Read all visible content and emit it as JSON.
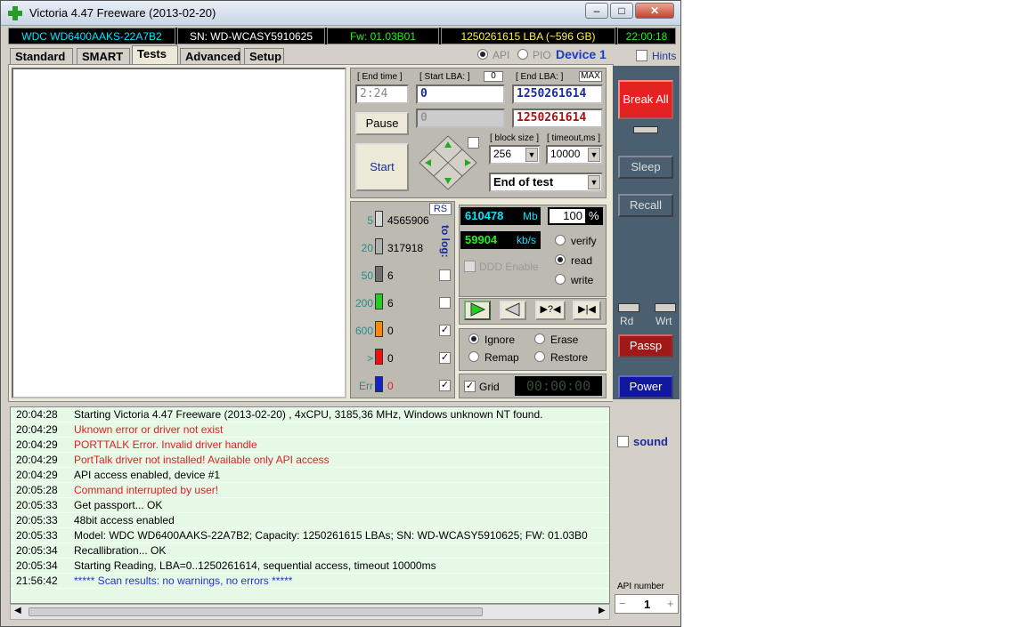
{
  "window": {
    "title": "Victoria 4.47  Freeware (2013-02-20)",
    "min": "–",
    "max": "□",
    "close": "✕"
  },
  "info": {
    "model": "WDC WD6400AAKS-22A7B2",
    "serial": "SN: WD-WCASY5910625",
    "fw": "Fw: 01.03B01",
    "lba": "1250261615 LBA (~596 GB)",
    "time": "22:00:18"
  },
  "tabs": [
    "Standard",
    "SMART",
    "Tests",
    "Advanced",
    "Setup"
  ],
  "mode": {
    "api": "API",
    "pio": "PIO",
    "device": "Device 1",
    "hints": "Hints"
  },
  "tests": {
    "end_time_label": "[ End time ]",
    "end_time": "2:24",
    "start_lba_label": "[ Start LBA: ]",
    "start_lba_badge": "0",
    "start_lba": "0",
    "start_lba2": "0",
    "end_lba_label": "[ End LBA: ]",
    "end_lba_badge": "MAX",
    "end_lba": "1250261614",
    "end_lba2": "1250261614",
    "pause": "Pause",
    "start": "Start",
    "block_size_label": "[ block size ]",
    "block_size": "256",
    "timeout_label": "[ timeout,ms ]",
    "timeout": "10000",
    "end_action": "End of test"
  },
  "blocks": {
    "rs": "RS",
    "to_log": "to log:",
    "rows": [
      {
        "label": "5",
        "count": "4565906",
        "color": "#d8d8d8"
      },
      {
        "label": "20",
        "count": "317918",
        "color": "#b0b0b0"
      },
      {
        "label": "50",
        "count": "6",
        "color": "#707070"
      },
      {
        "label": "200",
        "count": "6",
        "color": "#22cc22"
      },
      {
        "label": "600",
        "count": "0",
        "color": "#ff8800"
      },
      {
        "label": ">",
        "count": "0",
        "color": "#ee1111"
      },
      {
        "label": "Err",
        "count": "0",
        "color": "#1122cc"
      }
    ]
  },
  "stats": {
    "mb": "610478",
    "mb_unit": "Mb",
    "percent": "100",
    "percent_unit": "%",
    "speed": "59904",
    "speed_unit": "kb/s",
    "ddd": "DDD Enable",
    "verify": "verify",
    "read": "read",
    "write": "write"
  },
  "actions": {
    "ignore": "Ignore",
    "erase": "Erase",
    "remap": "Remap",
    "restore": "Restore",
    "grid": "Grid",
    "timer": "00:00:00"
  },
  "right": {
    "break_all": "Break All",
    "sleep": "Sleep",
    "recall": "Recall",
    "rd": "Rd",
    "wrt": "Wrt",
    "passp": "Passp",
    "power": "Power",
    "sound": "sound",
    "api_number_label": "API number",
    "api_number": "1",
    "minus": "−",
    "plus": "+"
  },
  "log": [
    {
      "t": "20:04:28",
      "m": "Starting Victoria 4.47  Freeware (2013-02-20) , 4xCPU, 3185,36 MHz, Windows unknown NT found.",
      "c": "#000000"
    },
    {
      "t": "20:04:29",
      "m": "Uknown error or driver not exist",
      "c": "#dd2222"
    },
    {
      "t": "20:04:29",
      "m": "PORTTALK Error. Invalid driver handle",
      "c": "#dd2222"
    },
    {
      "t": "20:04:29",
      "m": "PortTalk driver not installed! Available only API access",
      "c": "#dd2222"
    },
    {
      "t": "20:04:29",
      "m": "API access enabled, device #1",
      "c": "#000000"
    },
    {
      "t": "20:05:28",
      "m": "Command interrupted by user!",
      "c": "#dd2222"
    },
    {
      "t": "20:05:33",
      "m": "Get passport... OK",
      "c": "#000000"
    },
    {
      "t": "20:05:33",
      "m": "48bit access enabled",
      "c": "#000000"
    },
    {
      "t": "20:05:33",
      "m": "Model: WDC WD6400AAKS-22A7B2; Capacity: 1250261615 LBAs; SN: WD-WCASY5910625; FW: 01.03B0",
      "c": "#000000"
    },
    {
      "t": "20:05:34",
      "m": "Recallibration... OK",
      "c": "#000000"
    },
    {
      "t": "20:05:34",
      "m": "Starting Reading, LBA=0..1250261614, sequential access, timeout 10000ms",
      "c": "#000000"
    },
    {
      "t": "21:56:42",
      "m": "***** Scan results: no warnings, no errors *****",
      "c": "#2233cc"
    }
  ]
}
